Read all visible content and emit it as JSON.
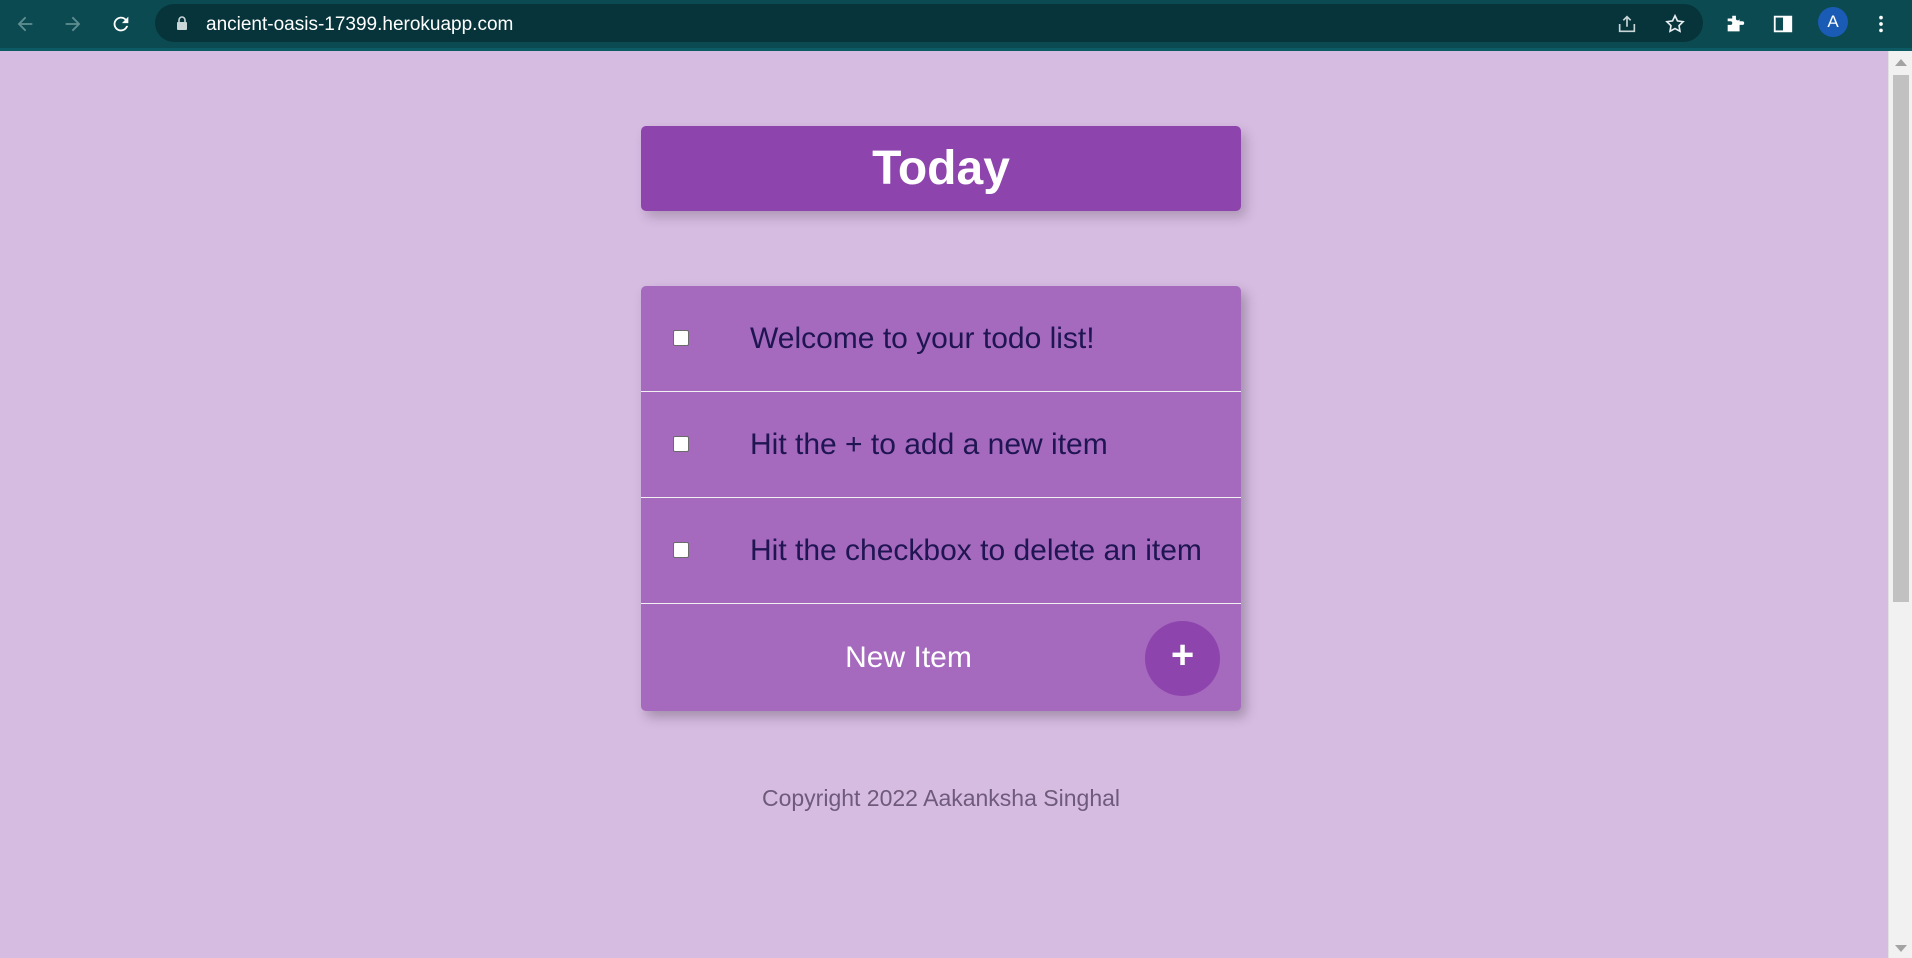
{
  "browser": {
    "url": "ancient-oasis-17399.herokuapp.com",
    "avatar_initial": "A",
    "icons": {
      "back": "arrow-left-icon",
      "forward": "arrow-right-icon",
      "reload": "reload-icon",
      "lock": "lock-icon",
      "share": "share-icon",
      "bookmark": "star-icon",
      "extensions": "puzzle-icon",
      "side_panel": "side-panel-icon",
      "menu": "kebab-menu-icon"
    }
  },
  "header": {
    "title": "Today"
  },
  "todo": {
    "items": [
      {
        "label": "Welcome to your todo list!",
        "checked": false
      },
      {
        "label": "Hit the + to add a new item",
        "checked": false
      },
      {
        "label": "Hit the checkbox to delete an item",
        "checked": false
      }
    ],
    "new_item_placeholder": "New Item",
    "add_button_label": "+"
  },
  "footer": {
    "text": "Copyright 2022 Aakanksha Singhal"
  },
  "colors": {
    "page_background": "#d7bce2",
    "accent": "#8e44ad",
    "list_background": "#a569bd",
    "item_text": "#1f1552",
    "browser_toolbar": "#0b4a51"
  }
}
